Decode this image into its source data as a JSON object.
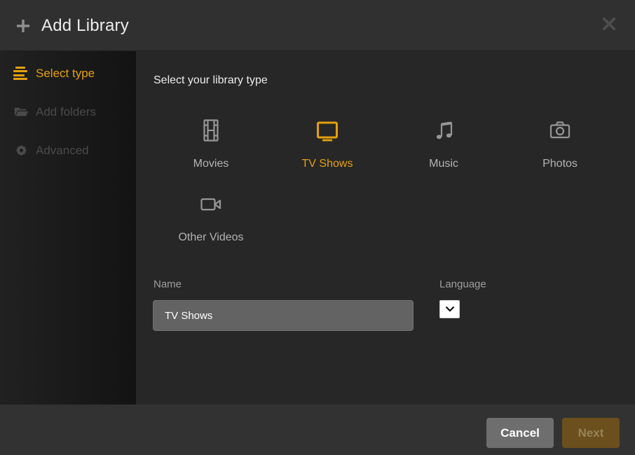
{
  "header": {
    "title": "Add Library"
  },
  "sidebar": {
    "items": [
      {
        "label": "Select type",
        "icon": "lines-icon",
        "active": true
      },
      {
        "label": "Add folders",
        "icon": "folder-icon",
        "active": false
      },
      {
        "label": "Advanced",
        "icon": "gear-icon",
        "active": false
      }
    ]
  },
  "main": {
    "heading": "Select your library type",
    "types": [
      {
        "label": "Movies",
        "icon": "film-icon",
        "selected": false
      },
      {
        "label": "TV Shows",
        "icon": "tv-icon",
        "selected": true
      },
      {
        "label": "Music",
        "icon": "music-note-icon",
        "selected": false
      },
      {
        "label": "Photos",
        "icon": "camera-icon",
        "selected": false
      },
      {
        "label": "Other Videos",
        "icon": "video-camera-icon",
        "selected": false
      }
    ],
    "name_field": {
      "label": "Name",
      "value": "TV Shows"
    },
    "language_field": {
      "label": "Language",
      "value": "",
      "icon": "chevron-down-icon"
    }
  },
  "footer": {
    "cancel_label": "Cancel",
    "next_label": "Next",
    "next_disabled": true
  },
  "colors": {
    "accent": "#e5a00d",
    "header_bg": "#303030",
    "main_bg": "#272727",
    "footer_bg": "#323232",
    "cancel_bg": "#6e6e6e",
    "next_disabled_bg": "#6b4f1d"
  }
}
